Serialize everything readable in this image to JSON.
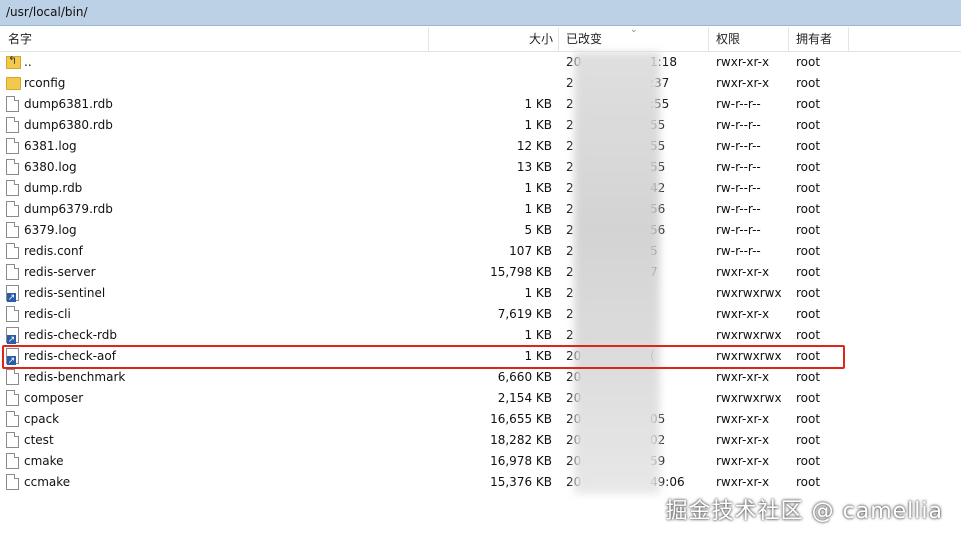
{
  "path": "/usr/local/bin/",
  "columns": {
    "name": "名字",
    "size": "大小",
    "modified": "已改变",
    "permissions": "权限",
    "owner": "拥有者"
  },
  "rows": [
    {
      "name": "..",
      "type": "up",
      "size": "",
      "date": "20",
      "date_end": "1:18",
      "perm": "rwxr-xr-x",
      "owner": "root"
    },
    {
      "name": "rconfig",
      "type": "folder",
      "size": "",
      "date": "2",
      "date_end": ":37",
      "perm": "rwxr-xr-x",
      "owner": "root"
    },
    {
      "name": "dump6381.rdb",
      "type": "file",
      "size": "1 KB",
      "date": "2",
      "date_end": ":55",
      "perm": "rw-r--r--",
      "owner": "root"
    },
    {
      "name": "dump6380.rdb",
      "type": "file",
      "size": "1 KB",
      "date": "2",
      "date_end": "55",
      "perm": "rw-r--r--",
      "owner": "root"
    },
    {
      "name": "6381.log",
      "type": "file",
      "size": "12 KB",
      "date": "2",
      "date_end": "55",
      "perm": "rw-r--r--",
      "owner": "root"
    },
    {
      "name": "6380.log",
      "type": "file",
      "size": "13 KB",
      "date": "2",
      "date_end": "55",
      "perm": "rw-r--r--",
      "owner": "root"
    },
    {
      "name": "dump.rdb",
      "type": "file",
      "size": "1 KB",
      "date": "2",
      "date_end": "42",
      "perm": "rw-r--r--",
      "owner": "root"
    },
    {
      "name": "dump6379.rdb",
      "type": "file",
      "size": "1 KB",
      "date": "2",
      "date_end": "56",
      "perm": "rw-r--r--",
      "owner": "root"
    },
    {
      "name": "6379.log",
      "type": "file",
      "size": "5 KB",
      "date": "2",
      "date_end": "56",
      "perm": "rw-r--r--",
      "owner": "root"
    },
    {
      "name": "redis.conf",
      "type": "file",
      "size": "107 KB",
      "date": "2",
      "date_end": "5",
      "perm": "rw-r--r--",
      "owner": "root"
    },
    {
      "name": "redis-server",
      "type": "file",
      "size": "15,798 KB",
      "date": "2",
      "date_end": "7",
      "perm": "rwxr-xr-x",
      "owner": "root"
    },
    {
      "name": "redis-sentinel",
      "type": "link",
      "size": "1 KB",
      "date": "2",
      "date_end": "",
      "perm": "rwxrwxrwx",
      "owner": "root"
    },
    {
      "name": "redis-cli",
      "type": "file",
      "size": "7,619 KB",
      "date": "2",
      "date_end": "",
      "perm": "rwxr-xr-x",
      "owner": "root"
    },
    {
      "name": "redis-check-rdb",
      "type": "link",
      "size": "1 KB",
      "date": "2",
      "date_end": "",
      "perm": "rwxrwxrwx",
      "owner": "root"
    },
    {
      "name": "redis-check-aof",
      "type": "link",
      "size": "1 KB",
      "date": "20",
      "date_end": "(",
      "perm": "rwxrwxrwx",
      "owner": "root"
    },
    {
      "name": "redis-benchmark",
      "type": "file",
      "size": "6,660 KB",
      "date": "20",
      "date_end": "",
      "perm": "rwxr-xr-x",
      "owner": "root"
    },
    {
      "name": "composer",
      "type": "file",
      "size": "2,154 KB",
      "date": "20",
      "date_end": "",
      "perm": "rwxrwxrwx",
      "owner": "root"
    },
    {
      "name": "cpack",
      "type": "file",
      "size": "16,655 KB",
      "date": "20",
      "date_end": "05",
      "perm": "rwxr-xr-x",
      "owner": "root"
    },
    {
      "name": "ctest",
      "type": "file",
      "size": "18,282 KB",
      "date": "20",
      "date_end": "02",
      "perm": "rwxr-xr-x",
      "owner": "root"
    },
    {
      "name": "cmake",
      "type": "file",
      "size": "16,978 KB",
      "date": "20",
      "date_end": "59",
      "perm": "rwxr-xr-x",
      "owner": "root"
    },
    {
      "name": "ccmake",
      "type": "file",
      "size": "15,376 KB",
      "date": "20",
      "date_end": "49:06",
      "perm": "rwxr-xr-x",
      "owner": "root"
    }
  ],
  "watermark": "掘金技术社区 @ camellia",
  "colors": {
    "highlight": "#e2231a",
    "pathbar": "#bcd0e6"
  }
}
